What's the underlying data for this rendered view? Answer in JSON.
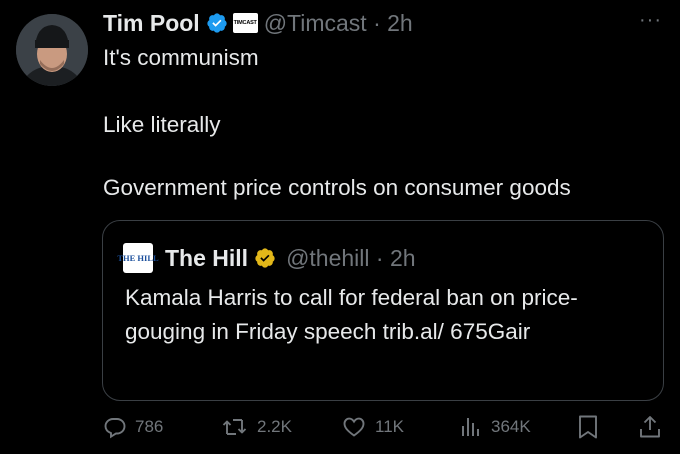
{
  "tweet": {
    "author_name": "Tim Pool",
    "affiliate_badge": "TIMCAST",
    "handle_time": "@Timcast · 2h",
    "more": "···",
    "lines": [
      "It's communism",
      "Like literally",
      "Government price controls on consumer goods"
    ]
  },
  "quote": {
    "logo_text": "THE HILL",
    "author_name": "The Hill",
    "handle_time": "@thehill · 2h",
    "text": "Kamala Harris to call for federal ban on price-gouging in Friday speech trib.al/ 675Gair"
  },
  "actions": {
    "replies": "786",
    "reposts": "2.2K",
    "likes": "11K",
    "views": "364K"
  },
  "colors": {
    "background": "#000000",
    "text": "#e7e9ea",
    "muted": "#71767b",
    "verified_blue": "#1d9bf0",
    "verified_gold": "#e2b719",
    "border": "#3a3f44"
  }
}
